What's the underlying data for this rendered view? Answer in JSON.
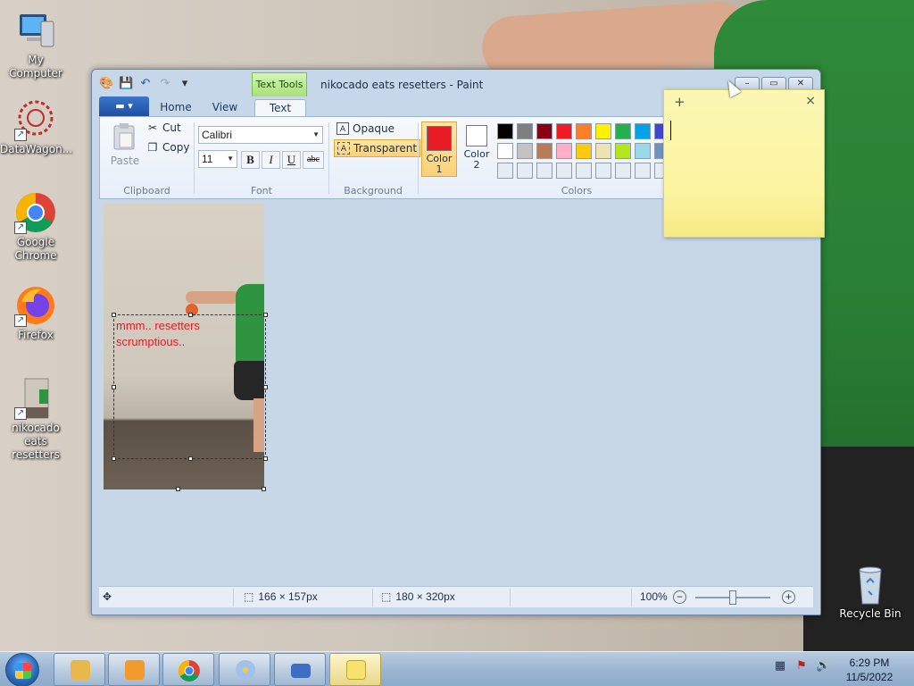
{
  "desktop": {
    "icons": [
      {
        "label": "My Computer",
        "icon": "computer-icon"
      },
      {
        "label": "DataWagon...",
        "icon": "datawagon-icon"
      },
      {
        "label": "Google Chrome",
        "icon": "chrome-icon"
      },
      {
        "label": "Firefox",
        "icon": "firefox-icon"
      },
      {
        "label": "nikocado eats resetters",
        "icon": "image-file-icon"
      },
      {
        "label": "Recycle Bin",
        "icon": "recycle-bin-icon"
      }
    ]
  },
  "paint": {
    "title": "nikocado eats resetters - Paint",
    "contextual_tab": "Text Tools",
    "file_menu_glyph": "▾",
    "tabs": [
      "Home",
      "View",
      "Text"
    ],
    "active_tab": "Text",
    "clipboard": {
      "paste": "Paste",
      "cut": "Cut",
      "copy": "Copy",
      "label": "Clipboard"
    },
    "font": {
      "family": "Calibri",
      "size": "11",
      "bold": "B",
      "italic": "I",
      "underline": "U",
      "strike": "abc",
      "label": "Font"
    },
    "background": {
      "opaque": "Opaque",
      "transparent": "Transparent",
      "selected": "Transparent",
      "label": "Background"
    },
    "colors": {
      "color1_label": "Color\n1",
      "color2_label": "Color\n2",
      "color1": "#e81c24",
      "color2": "#ffffff",
      "label": "Colors",
      "palette_row1": [
        "#000000",
        "#7f7f7f",
        "#880015",
        "#ed1c24",
        "#ff7f27",
        "#fff200",
        "#22b14c",
        "#00a2e8",
        "#3f48cc"
      ],
      "palette_row2": [
        "#ffffff",
        "#c3c3c3",
        "#b97a57",
        "#ffaec9",
        "#ffc90e",
        "#efe4b0",
        "#b5e61d",
        "#99d9ea",
        "#7092be"
      ],
      "palette_row3": [
        "#e6ecf3",
        "#e6ecf3",
        "#e6ecf3",
        "#e6ecf3",
        "#e6ecf3",
        "#e6ecf3",
        "#e6ecf3",
        "#e6ecf3",
        "#e6ecf3"
      ]
    },
    "canvas_text_line1": "mmm.. resetters",
    "canvas_text_line2": "scrumptious..",
    "status": {
      "selection_size": "166 × 157px",
      "image_size": "180 × 320px",
      "zoom": "100%"
    }
  },
  "sticky_note": {
    "add": "+",
    "close": "×"
  },
  "taskbar": {
    "items": [
      {
        "name": "explorer",
        "color": "#e8b84a"
      },
      {
        "name": "media-player",
        "color": "#f29a2e"
      },
      {
        "name": "chrome",
        "color": "#2f8be8"
      },
      {
        "name": "paint",
        "color": "#c9d9ef"
      },
      {
        "name": "on-screen-keyboard",
        "color": "#3a6fc4"
      },
      {
        "name": "sticky-notes",
        "color": "#f7e36c"
      }
    ],
    "time": "6:29 PM",
    "date": "11/5/2022"
  }
}
